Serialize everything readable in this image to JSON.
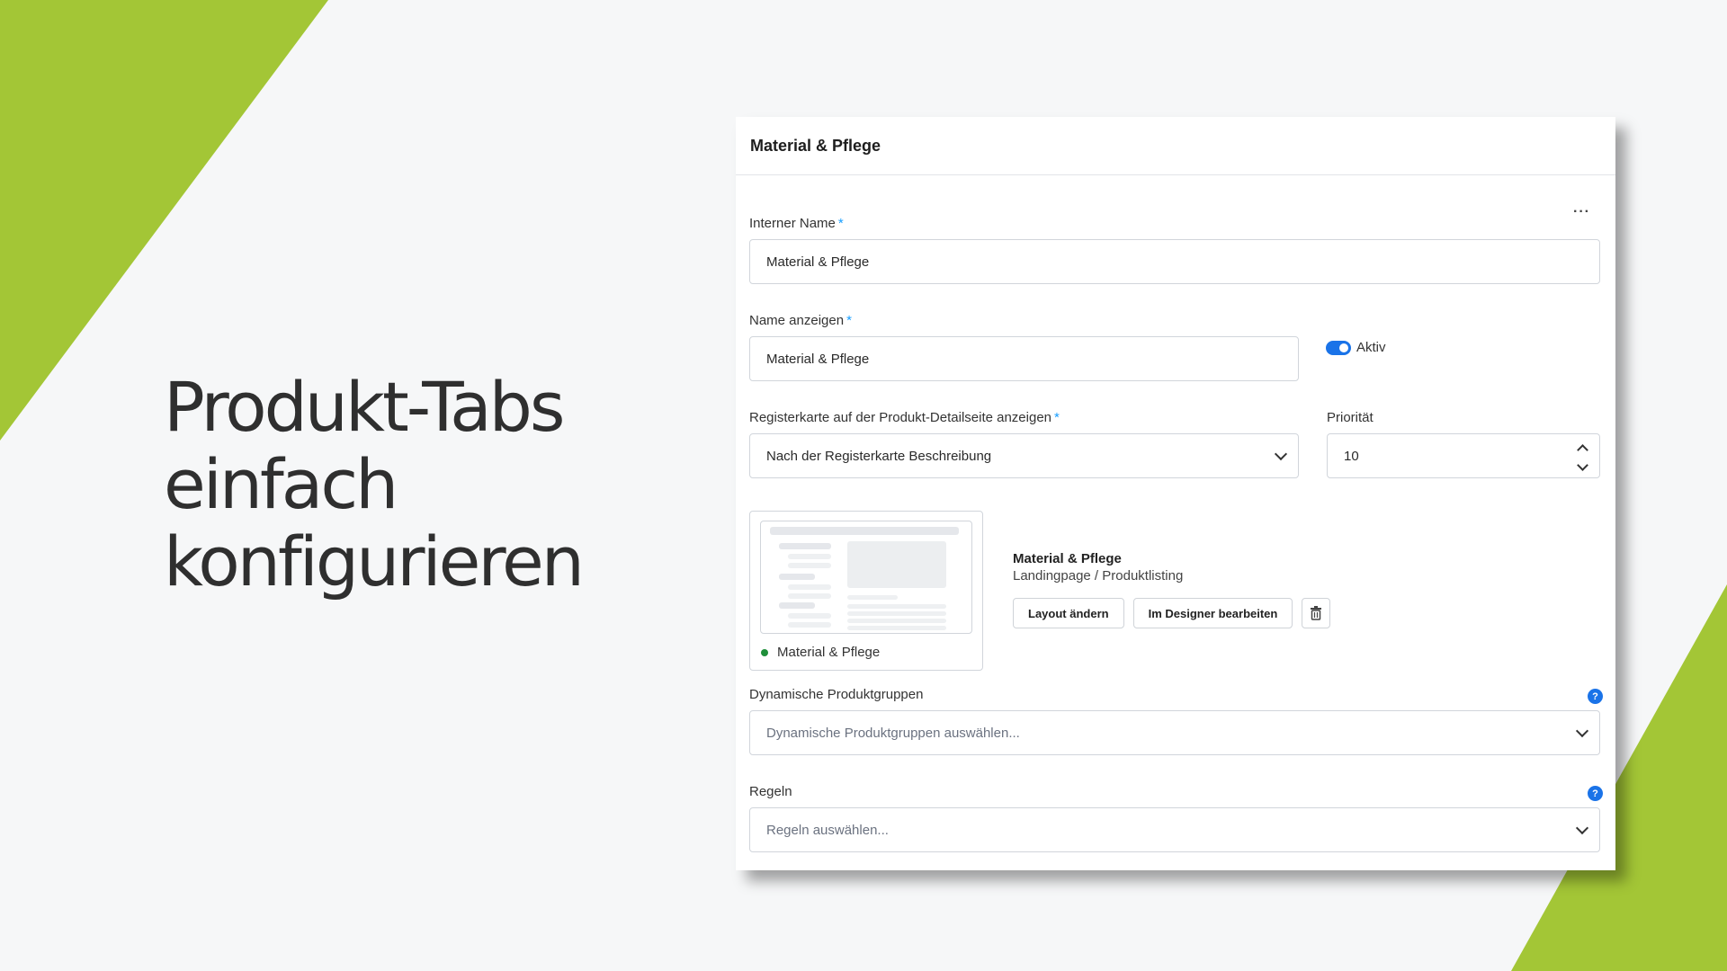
{
  "headline": [
    "Produkt-Tabs",
    "einfach",
    "konfigurieren"
  ],
  "card": {
    "title": "Material & Pflege",
    "more_label": "···"
  },
  "form": {
    "internal_name": {
      "label": "Interner Name",
      "required": "*",
      "value": "Material & Pflege"
    },
    "display_name": {
      "label": "Name anzeigen",
      "required": "*",
      "value": "Material & Pflege"
    },
    "active": {
      "label": "Aktiv",
      "checked": true
    },
    "tab_position": {
      "label": "Registerkarte auf der Produkt-Detailseite anzeigen",
      "required": "*",
      "value": "Nach der Registerkarte Beschreibung"
    },
    "priority": {
      "label": "Priorität",
      "value": "10"
    },
    "dynamic_groups": {
      "label": "Dynamische Produktgruppen",
      "placeholder": "Dynamische Produktgruppen auswählen..."
    },
    "rules": {
      "label": "Regeln",
      "placeholder": "Regeln auswählen..."
    }
  },
  "layout": {
    "status_label": "Material & Pflege",
    "title": "Material & Pflege",
    "subtitle": "Landingpage / Produktlisting",
    "change_button": "Layout ändern",
    "designer_button": "Im Designer bearbeiten"
  },
  "colors": {
    "accent_green": "#a3c636",
    "toggle_blue": "#1a73e8",
    "required_blue": "#189eff"
  },
  "icons": {
    "help": "?"
  }
}
